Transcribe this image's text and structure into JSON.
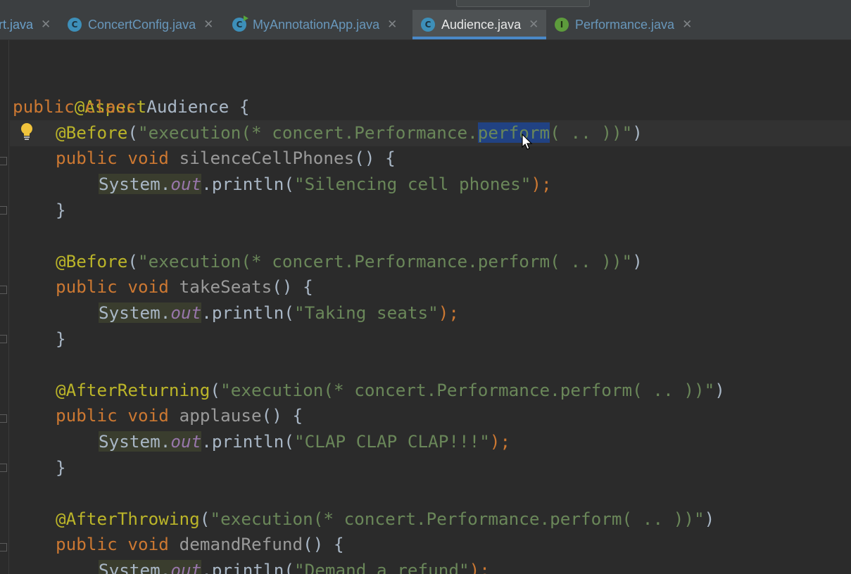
{
  "tabs": [
    {
      "label": "rt.java",
      "icon": "none",
      "active": false
    },
    {
      "label": "ConcertConfig.java",
      "icon": "class-icon",
      "active": false
    },
    {
      "label": "MyAnnotationApp.java",
      "icon": "runnable-class-icon",
      "active": false
    },
    {
      "label": "Audience.java",
      "icon": "class-icon",
      "active": true
    },
    {
      "label": "Performance.java",
      "icon": "interface-icon",
      "active": false
    }
  ],
  "tab_close_glyph": "✕",
  "icon_letters": {
    "class": "C",
    "interface": "I"
  },
  "code": {
    "aspect_annotation": "@Aspect",
    "class_decl": {
      "kw1": "public",
      "kw2": "class",
      "name": "Audience",
      "brace": " {"
    },
    "methods": [
      {
        "annotation": "@Before",
        "pointcut_prefix": "\"execution(* concert.Performance.",
        "pointcut_selected": "perform",
        "pointcut_suffix": "( .. ))\"",
        "modifiers": "public void",
        "name": "silenceCellPhones",
        "params": "() {",
        "sys": "System.",
        "out": "out",
        "println": ".println(",
        "message": "\"Silencing cell phones\"",
        "end": ");",
        "close": "}"
      },
      {
        "annotation": "@Before",
        "pointcut": "\"execution(* concert.Performance.perform( .. ))\"",
        "modifiers": "public void",
        "name": "takeSeats",
        "params": "() {",
        "sys": "System.",
        "out": "out",
        "println": ".println(",
        "message": "\"Taking seats\"",
        "end": ");",
        "close": "}"
      },
      {
        "annotation": "@AfterReturning",
        "pointcut": "\"execution(* concert.Performance.perform( .. ))\"",
        "modifiers": "public void",
        "name": "applause",
        "params": "() {",
        "sys": "System.",
        "out": "out",
        "println": ".println(",
        "message": "\"CLAP CLAP CLAP!!!\"",
        "end": ");",
        "close": "}"
      },
      {
        "annotation": "@AfterThrowing",
        "pointcut": "\"execution(* concert.Performance.perform( .. ))\"",
        "modifiers": "public void",
        "name": "demandRefund",
        "params": "() {",
        "sys": "System.",
        "out": "out",
        "println": ".println(",
        "message": "\"Demand a refund\"",
        "end": ");"
      }
    ]
  },
  "colors": {
    "keyword": "#cc7832",
    "annotation": "#bbb529",
    "string": "#6a8759",
    "field": "#9876aa",
    "selection": "#214283",
    "active_tab_underline": "#4a88c7"
  }
}
